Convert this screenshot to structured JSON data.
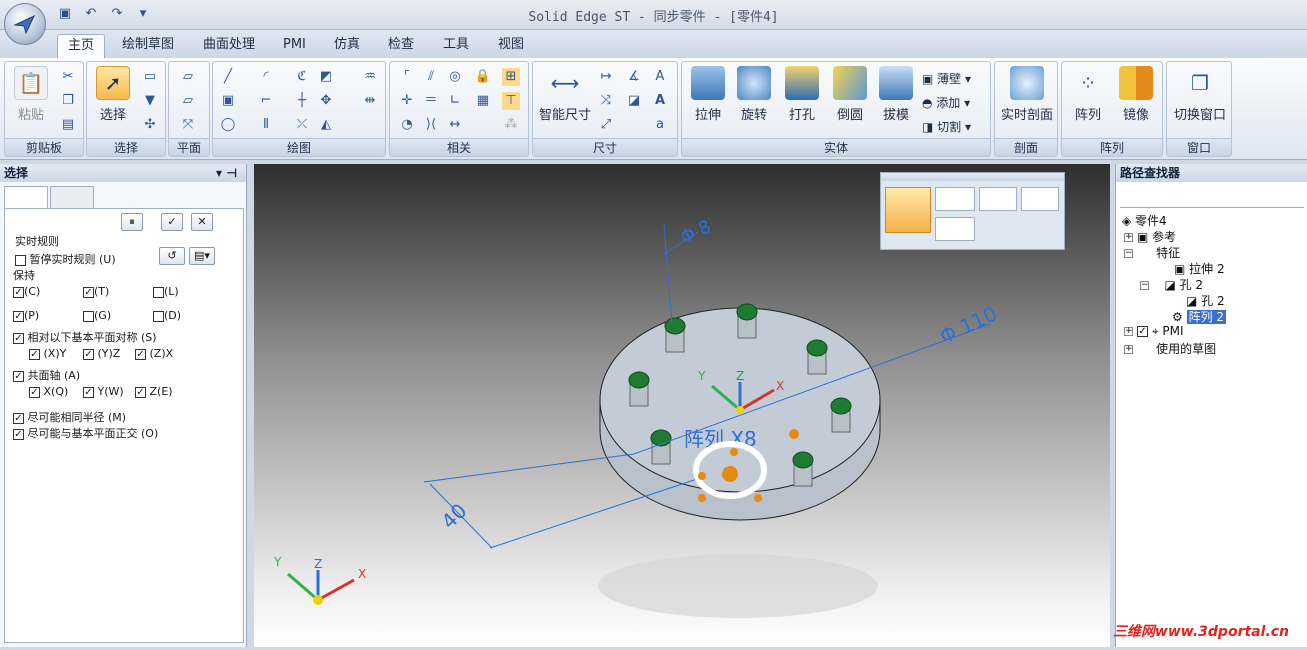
{
  "app": {
    "title": "Solid Edge ST - 同步零件 - [零件4]"
  },
  "tabs": [
    "主页",
    "绘制草图",
    "曲面处理",
    "PMI",
    "仿真",
    "检查",
    "工具",
    "视图"
  ],
  "ribbon": {
    "clipboard": {
      "label": "剪贴板",
      "paste": "粘贴"
    },
    "select": {
      "label": "选择",
      "button": "选择"
    },
    "plane": {
      "label": "平面"
    },
    "draw": {
      "label": "绘图"
    },
    "relate": {
      "label": "相关"
    },
    "dimension": {
      "label": "尺寸",
      "smart": "智能尺寸"
    },
    "solid": {
      "label": "实体",
      "extrude": "拉伸",
      "revolve": "旋转",
      "hole": "打孔",
      "round": "倒圆",
      "draft": "拔模",
      "thin": "薄壁",
      "add": "添加",
      "cut": "切割"
    },
    "section": {
      "label": "剖面",
      "live": "实时剖面"
    },
    "pattern": {
      "label": "阵列",
      "pattern": "阵列",
      "mirror": "镜像"
    },
    "window": {
      "label": "窗口",
      "switch": "切换窗口"
    }
  },
  "left": {
    "title": "选择",
    "live_rules": "实时规则",
    "pause": "暂停实时规则 (U)",
    "keep": "保持",
    "keys": [
      "(C)",
      "(T)",
      "(L)",
      "(P)",
      "(G)",
      "(D)"
    ],
    "sym": "相对以下基本平面对称 (S)",
    "sym_axes": [
      "(X)Y",
      "(Y)Z",
      "(Z)X"
    ],
    "coaxial": "共面轴 (A)",
    "axes": [
      "X(Q)",
      "Y(W)",
      "Z(E)"
    ],
    "same_radius": "尽可能相同半径 (M)",
    "ortho": "尽可能与基本平面正交 (O)"
  },
  "viewport": {
    "dim_hole": "Φ 8",
    "dim_dia": "Φ 110",
    "dim_len": "40",
    "pattern_text": "阵列 X8",
    "axis_x": "X",
    "axis_y": "Y",
    "axis_z": "Z"
  },
  "right": {
    "title": "路径查找器",
    "items": [
      "零件4",
      "参考",
      "特征",
      "拉伸 2",
      "孔 2",
      "孔 2",
      "阵列 2",
      "PMI",
      "使用的草图"
    ]
  },
  "watermark": "三维网www.3dportal.cn"
}
